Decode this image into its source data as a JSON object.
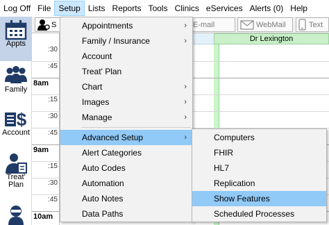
{
  "menubar": {
    "items": [
      "Log Off",
      "File",
      "Setup",
      "Lists",
      "Reports",
      "Tools",
      "Clinics",
      "eServices",
      "Alerts (0)",
      "Help"
    ]
  },
  "modules": [
    {
      "label": "Appts",
      "icon": "calendar-icon"
    },
    {
      "label": "Family",
      "icon": "family-icon"
    },
    {
      "label": "Account",
      "icon": "dollar-icon"
    },
    {
      "label": "Treat' Plan",
      "icon": "treatment-plan-icon"
    },
    {
      "label": "",
      "icon": "chart-icon"
    }
  ],
  "toolbar": {
    "patient_label": "S",
    "email_label": "E-mail",
    "webmail_label": "WebMail",
    "text_label": "Text"
  },
  "schedule": {
    "provider": "Dr Lexington",
    "times": [
      ":30",
      ":45",
      "8am",
      ":15",
      ":30",
      ":45",
      "9am",
      ":15",
      ":30",
      ":45",
      "10am"
    ]
  },
  "setup_menu": {
    "items": [
      {
        "label": "Appointments",
        "submenu": true
      },
      {
        "label": "Family / Insurance",
        "submenu": true
      },
      {
        "label": "Account",
        "submenu": false
      },
      {
        "label": "Treat' Plan",
        "submenu": false
      },
      {
        "label": "Chart",
        "submenu": true
      },
      {
        "label": "Images",
        "submenu": true
      },
      {
        "label": "Manage",
        "submenu": true
      },
      {
        "label": "Advanced Setup",
        "submenu": true
      },
      {
        "label": "Alert Categories",
        "submenu": false
      },
      {
        "label": "Auto Codes",
        "submenu": false
      },
      {
        "label": "Automation",
        "submenu": false
      },
      {
        "label": "Auto Notes",
        "submenu": false
      },
      {
        "label": "Data Paths",
        "submenu": false
      }
    ]
  },
  "advanced_menu": {
    "items": [
      "Computers",
      "FHIR",
      "HL7",
      "Replication",
      "Show Features",
      "Scheduled Processes"
    ]
  },
  "colors": {
    "menu_highlight": "#91c9f7",
    "provider_green": "#c9f0c9",
    "module_selected": "#c5d3e8"
  }
}
